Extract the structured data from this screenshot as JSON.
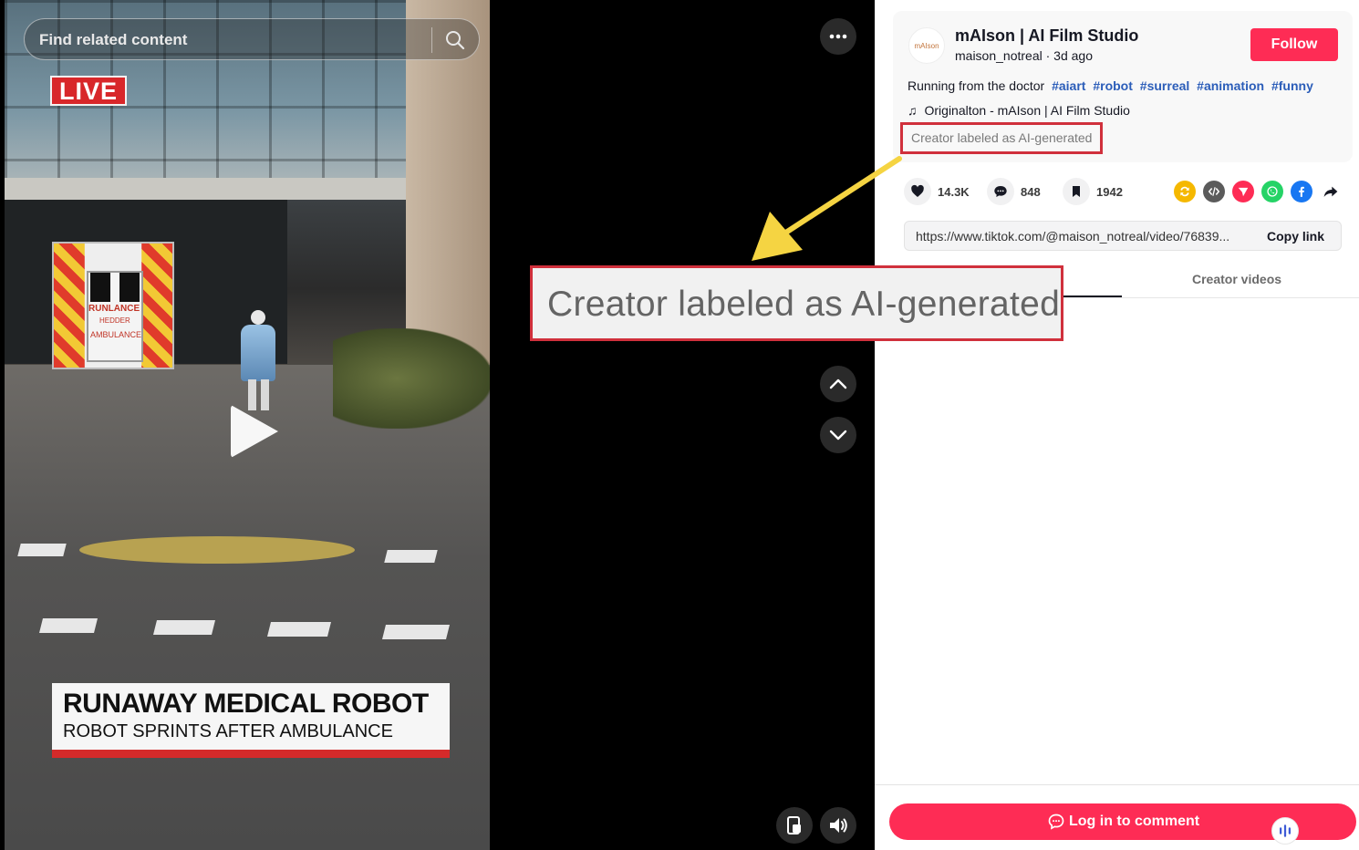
{
  "search": {
    "placeholder": "Find related content"
  },
  "live_badge": "LIVE",
  "video": {
    "ambulance_text_1": "RUNLANCE",
    "ambulance_text_2": "HEDDER",
    "ambulance_text_3": "AMBULANCE",
    "headline": "RUNAWAY MEDICAL ROBOT",
    "subhead": "ROBOT SPRINTS AFTER AMBULANCE"
  },
  "callout": {
    "text": "Creator labeled as AI-generated"
  },
  "author": {
    "avatar_text": "mAIson",
    "name": "mAIson | AI Film Studio",
    "meta": "maison_notreal · 3d ago",
    "follow_label": "Follow"
  },
  "post": {
    "description": "Running from the doctor",
    "hashtags": [
      "#aiart",
      "#robot",
      "#surreal",
      "#animation",
      "#funny"
    ],
    "music": "Originalton - mAIson | AI Film Studio",
    "ai_label": "Creator labeled as AI-generated"
  },
  "stats": {
    "likes": "14.3K",
    "comments": "848",
    "saves": "1942"
  },
  "share_icons": [
    {
      "name": "repost-icon",
      "color": "#f5b800"
    },
    {
      "name": "embed-icon",
      "color": "#5b5b5b"
    },
    {
      "name": "send-icon",
      "color": "#fe2c55"
    },
    {
      "name": "whatsapp-icon",
      "color": "#25d366"
    },
    {
      "name": "facebook-icon",
      "color": "#1877f2"
    }
  ],
  "link": {
    "url": "https://www.tiktok.com/@maison_notreal/video/76839...",
    "copy_label": "Copy link"
  },
  "tabs": {
    "creator_videos": "Creator videos"
  },
  "comment": {
    "login_label": "Log in to comment"
  },
  "colors": {
    "accent": "#fe2c55",
    "callout_border": "#d0303c",
    "arrow": "#f5d442",
    "hashtag": "#2b5db9"
  }
}
